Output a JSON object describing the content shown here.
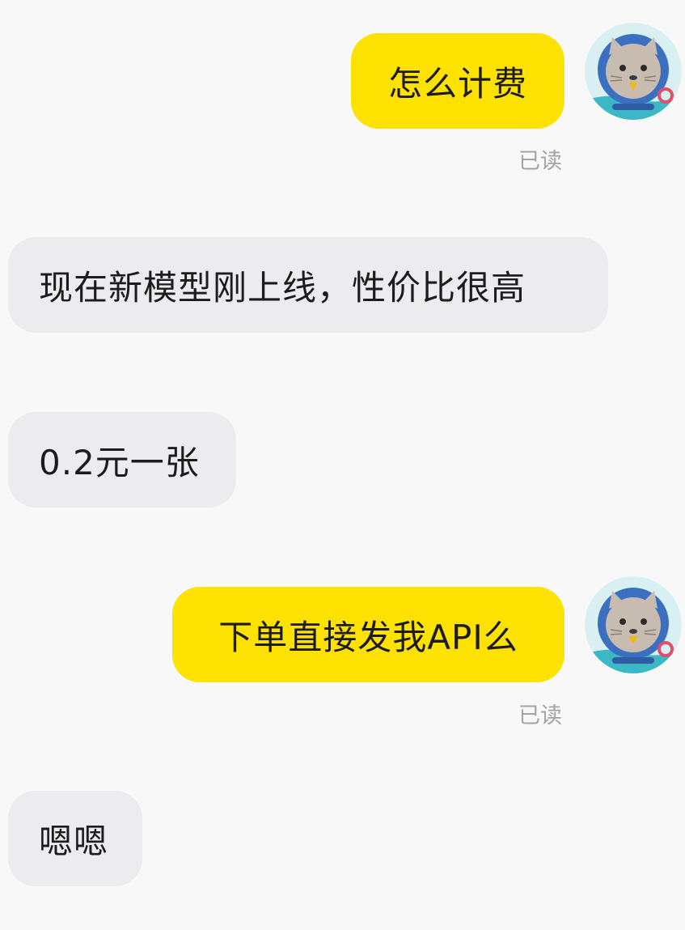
{
  "messages": [
    {
      "id": "m1",
      "side": "outgoing",
      "text": "怎么计费",
      "status": "已读"
    },
    {
      "id": "m2",
      "side": "incoming",
      "text": "现在新模型刚上线，性价比很高"
    },
    {
      "id": "m3",
      "side": "incoming",
      "text": "0.2元一张"
    },
    {
      "id": "m4",
      "side": "outgoing",
      "text": "下单直接发我API么",
      "status": "已读"
    },
    {
      "id": "m5",
      "side": "incoming",
      "text": "嗯嗯"
    }
  ],
  "avatar": {
    "icon": "cat-astronaut-avatar-icon"
  },
  "colors": {
    "outgoing_bubble": "#fde100",
    "incoming_bubble": "#ececef",
    "background": "#f8f8f8",
    "read_status": "#a3a3a3"
  }
}
